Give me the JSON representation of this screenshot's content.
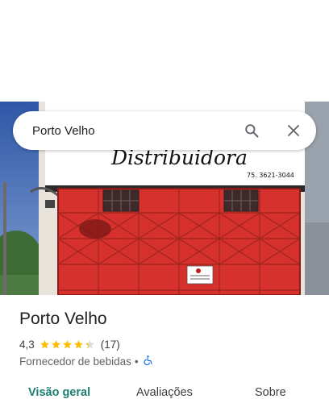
{
  "search": {
    "query": "Porto Velho"
  },
  "photo": {
    "sign_text": "Distribuidora",
    "phone_text": "75. 3621-3044"
  },
  "place": {
    "name": "Porto Velho",
    "rating": "4,3",
    "stars": 4.3,
    "review_count": "(17)",
    "category": "Fornecedor de bebidas",
    "separator": "•",
    "accessibility_icon": "wheelchair-icon"
  },
  "tabs": [
    {
      "label": "Visão geral",
      "active": true
    },
    {
      "label": "Avaliações",
      "active": false
    },
    {
      "label": "Sobre",
      "active": false
    }
  ],
  "colors": {
    "star": "#fbbc04",
    "active_tab": "#1a7f72",
    "accessibility": "#1a73e8",
    "door_red": "#d6312d"
  }
}
